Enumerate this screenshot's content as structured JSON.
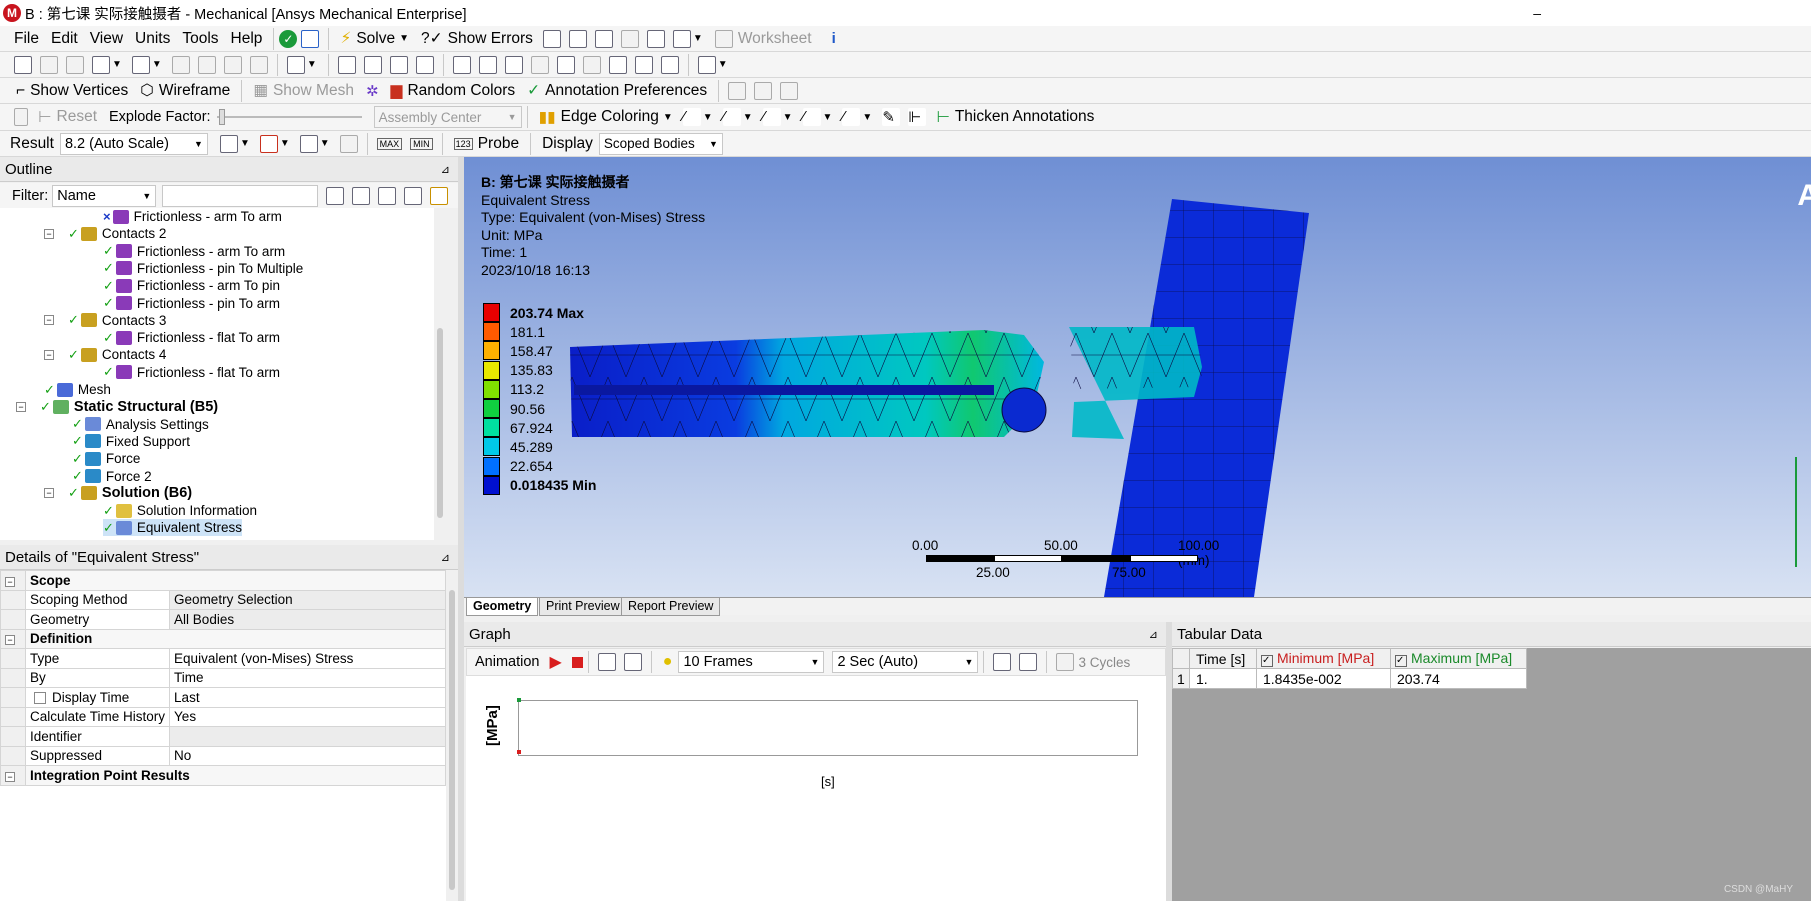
{
  "window": {
    "title": "B : 第七课 实际接触摄者 - Mechanical [Ansys Mechanical Enterprise]",
    "minimize": "–"
  },
  "menu": [
    "File",
    "Edit",
    "View",
    "Units",
    "Tools",
    "Help"
  ],
  "toolbar1": {
    "solve": "Solve",
    "show_errors": "Show Errors",
    "worksheet": "Worksheet"
  },
  "toolbar3": {
    "show_vertices": "Show Vertices",
    "wireframe": "Wireframe",
    "show_mesh": "Show Mesh",
    "random_colors": "Random Colors",
    "annotation_preferences": "Annotation Preferences"
  },
  "toolbar4": {
    "reset": "Reset",
    "explode_factor": "Explode Factor:",
    "assembly_center": "Assembly Center",
    "edge_coloring": "Edge Coloring",
    "thicken_annotations": "Thicken Annotations"
  },
  "toolbar5": {
    "result": "Result",
    "scale": "8.2 (Auto Scale)",
    "probe": "Probe",
    "display": "Display",
    "scoped_bodies": "Scoped Bodies",
    "max_icon": "MAX",
    "min_icon": "MIN"
  },
  "outline": {
    "title": "Outline",
    "filter_label": "Filter:",
    "filter_value": "Name",
    "pin": "⊿",
    "nodes": [
      {
        "label": "Frictionless - arm To arm",
        "check": "×"
      },
      {
        "label": "Contacts 2",
        "check": "✓",
        "pm": "−"
      },
      {
        "label": "Frictionless - arm To arm",
        "check": "✓"
      },
      {
        "label": "Frictionless - pin To Multiple",
        "check": "✓"
      },
      {
        "label": "Frictionless - arm To pin",
        "check": "✓"
      },
      {
        "label": "Frictionless - pin To arm",
        "check": "✓"
      },
      {
        "label": "Contacts 3",
        "check": "✓",
        "pm": "−"
      },
      {
        "label": "Frictionless - flat To arm",
        "check": "✓"
      },
      {
        "label": "Contacts 4",
        "check": "✓",
        "pm": "−"
      },
      {
        "label": "Frictionless - flat To arm",
        "check": "✓"
      },
      {
        "label": "Mesh",
        "check": "✓"
      },
      {
        "label": "Static Structural (B5)",
        "check": "✓",
        "pm": "−",
        "bold": true
      },
      {
        "label": "Analysis Settings",
        "check": "✓"
      },
      {
        "label": "Fixed Support",
        "check": "✓"
      },
      {
        "label": "Force",
        "check": "✓"
      },
      {
        "label": "Force 2",
        "check": "✓"
      },
      {
        "label": "Solution (B6)",
        "check": "✓",
        "pm": "−",
        "bold": true
      },
      {
        "label": "Solution Information",
        "check": "✓"
      },
      {
        "label": "Equivalent Stress",
        "check": "✓"
      }
    ]
  },
  "details": {
    "title": "Details of \"Equivalent Stress\"",
    "sections": [
      {
        "name": "Scope",
        "rows": [
          [
            "Scoping Method",
            "Geometry Selection"
          ],
          [
            "Geometry",
            "All Bodies"
          ]
        ]
      },
      {
        "name": "Definition",
        "rows": [
          [
            "Type",
            "Equivalent (von-Mises) Stress"
          ],
          [
            "By",
            "Time"
          ],
          [
            "Display Time",
            "Last"
          ],
          [
            "Calculate Time History",
            "Yes"
          ],
          [
            "Identifier",
            ""
          ],
          [
            "Suppressed",
            "No"
          ]
        ]
      },
      {
        "name": "Integration Point Results",
        "rows": []
      }
    ]
  },
  "viewport": {
    "header": [
      "B: 第七课 实际接触摄者",
      "Equivalent Stress",
      "Type: Equivalent (von-Mises) Stress",
      "Unit: MPa",
      "Time: 1",
      "2023/10/18 16:13"
    ],
    "legend": [
      {
        "v": "203.74 Max",
        "c": "#e80000"
      },
      {
        "v": "181.1",
        "c": "#ff5a00"
      },
      {
        "v": "158.47",
        "c": "#ffb000"
      },
      {
        "v": "135.83",
        "c": "#e8e800"
      },
      {
        "v": "113.2",
        "c": "#80e000"
      },
      {
        "v": "90.56",
        "c": "#10d040"
      },
      {
        "v": "67.924",
        "c": "#00e0a0"
      },
      {
        "v": "45.289",
        "c": "#00c8e8"
      },
      {
        "v": "22.654",
        "c": "#0070ff"
      },
      {
        "v": "0.018435 Min",
        "c": "#0010d0"
      }
    ],
    "scale": {
      "t0": "0.00",
      "t50": "50.00",
      "t100": "100.00 (mm)",
      "t25": "25.00",
      "t75": "75.00"
    },
    "brand": "A"
  },
  "tabs": [
    "Geometry",
    "Print Preview",
    "Report Preview"
  ],
  "graph": {
    "title": "Graph",
    "animation": "Animation",
    "frames": "10 Frames",
    "sec": "2 Sec (Auto)",
    "cycles": "3 Cycles",
    "ylabel": "[MPa]",
    "xlabel": "[s]"
  },
  "tabular": {
    "title": "Tabular Data",
    "headers": [
      "Time [s]",
      "Minimum [MPa]",
      "Maximum [MPa]"
    ],
    "rows": [
      [
        "1",
        "1.",
        "1.8435e-002",
        "203.74"
      ]
    ]
  },
  "watermark": "CSDN @MaHY"
}
